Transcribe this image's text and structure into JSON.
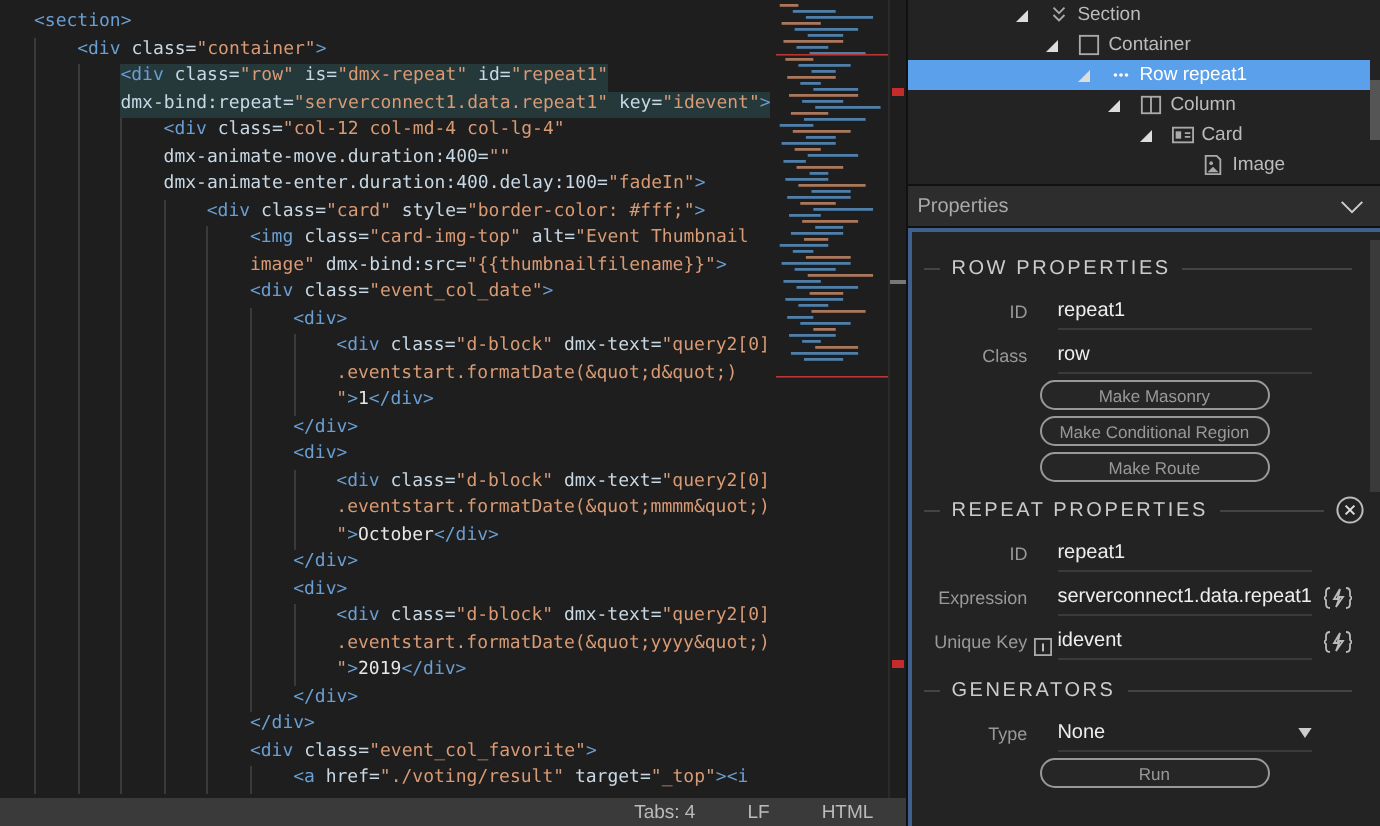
{
  "editor": {
    "lines": [
      {
        "highlighted": false,
        "parts": [
          {
            "kind": "tag",
            "text": "<section>"
          }
        ],
        "children": [
          {
            "highlighted": false,
            "parts": [
              {
                "kind": "tag",
                "text": "<div"
              },
              {
                "kind": "attr",
                "text": " class="
              },
              {
                "kind": "str",
                "text": "\"container\""
              },
              {
                "kind": "tag",
                "text": ">"
              }
            ],
            "children": [
              {
                "highlighted": true,
                "parts": [
                  {
                    "kind": "tag",
                    "text": "<div"
                  },
                  {
                    "kind": "attr",
                    "text": " class="
                  },
                  {
                    "kind": "str",
                    "text": "\"row\""
                  },
                  {
                    "kind": "attr",
                    "text": " is="
                  },
                  {
                    "kind": "str",
                    "text": "\"dmx-repeat\""
                  },
                  {
                    "kind": "attr",
                    "text": " id="
                  },
                  {
                    "kind": "str",
                    "text": "\"repeat1\""
                  }
                ]
              },
              {
                "highlighted": true,
                "parts": [
                  {
                    "kind": "attr",
                    "text": "dmx-bind:repeat="
                  },
                  {
                    "kind": "str",
                    "text": "\"serverconnect1.data.repeat1\""
                  },
                  {
                    "kind": "attr",
                    "text": " key="
                  },
                  {
                    "kind": "str",
                    "text": "\"idevent\""
                  },
                  {
                    "kind": "tag",
                    "text": ">"
                  }
                ],
                "children": [
                  {
                    "highlighted": false,
                    "parts": [
                      {
                        "kind": "tag",
                        "text": "<div"
                      },
                      {
                        "kind": "attr",
                        "text": " class="
                      },
                      {
                        "kind": "str",
                        "text": "\"col-12 col-md-4 col-lg-4\""
                      }
                    ]
                  },
                  {
                    "highlighted": false,
                    "parts": [
                      {
                        "kind": "attr",
                        "text": "dmx-animate-move.duration:400="
                      },
                      {
                        "kind": "str",
                        "text": "\"\""
                      }
                    ]
                  },
                  {
                    "highlighted": false,
                    "parts": [
                      {
                        "kind": "attr",
                        "text": "dmx-animate-enter.duration:400.delay:100="
                      },
                      {
                        "kind": "str",
                        "text": "\"fadeIn\""
                      },
                      {
                        "kind": "tag",
                        "text": ">"
                      }
                    ],
                    "children": [
                      {
                        "highlighted": false,
                        "parts": [
                          {
                            "kind": "tag",
                            "text": "<div"
                          },
                          {
                            "kind": "attr",
                            "text": " class="
                          },
                          {
                            "kind": "str",
                            "text": "\"card\""
                          },
                          {
                            "kind": "attr",
                            "text": " style="
                          },
                          {
                            "kind": "str",
                            "text": "\"border-color: #fff;\""
                          },
                          {
                            "kind": "tag",
                            "text": ">"
                          }
                        ],
                        "children": [
                          {
                            "highlighted": false,
                            "parts": [
                              {
                                "kind": "tag",
                                "text": "<img"
                              },
                              {
                                "kind": "attr",
                                "text": " class="
                              },
                              {
                                "kind": "str",
                                "text": "\"card-img-top\""
                              },
                              {
                                "kind": "attr",
                                "text": " alt="
                              },
                              {
                                "kind": "str",
                                "text": "\"Event Thumbnail"
                              }
                            ]
                          },
                          {
                            "highlighted": false,
                            "parts": [
                              {
                                "kind": "str",
                                "text": "image\""
                              },
                              {
                                "kind": "attr",
                                "text": " dmx-bind:src="
                              },
                              {
                                "kind": "str",
                                "text": "\"{{thumbnailfilename}}\""
                              },
                              {
                                "kind": "tag",
                                "text": ">"
                              }
                            ]
                          },
                          {
                            "highlighted": false,
                            "parts": [
                              {
                                "kind": "tag",
                                "text": "<div"
                              },
                              {
                                "kind": "attr",
                                "text": " class="
                              },
                              {
                                "kind": "str",
                                "text": "\"event_col_date\""
                              },
                              {
                                "kind": "tag",
                                "text": ">"
                              }
                            ],
                            "children": [
                              {
                                "highlighted": false,
                                "parts": [
                                  {
                                    "kind": "tag",
                                    "text": "<div>"
                                  }
                                ],
                                "children": [
                                  {
                                    "highlighted": false,
                                    "parts": [
                                      {
                                        "kind": "tag",
                                        "text": "<div"
                                      },
                                      {
                                        "kind": "attr",
                                        "text": " class="
                                      },
                                      {
                                        "kind": "str",
                                        "text": "\"d-block\""
                                      },
                                      {
                                        "kind": "attr",
                                        "text": " dmx-text="
                                      },
                                      {
                                        "kind": "str",
                                        "text": "\"query2[0]"
                                      }
                                    ]
                                  },
                                  {
                                    "highlighted": false,
                                    "parts": [
                                      {
                                        "kind": "str",
                                        "text": ".eventstart.formatDate(&quot;d&quot;)"
                                      }
                                    ]
                                  },
                                  {
                                    "highlighted": false,
                                    "parts": [
                                      {
                                        "kind": "str",
                                        "text": "\""
                                      },
                                      {
                                        "kind": "tag",
                                        "text": ">"
                                      },
                                      {
                                        "kind": "text",
                                        "text": "1"
                                      },
                                      {
                                        "kind": "tag",
                                        "text": "</div>"
                                      }
                                    ]
                                  }
                                ]
                              },
                              {
                                "highlighted": false,
                                "parts": [
                                  {
                                    "kind": "tag",
                                    "text": "</div>"
                                  }
                                ]
                              },
                              {
                                "highlighted": false,
                                "parts": [
                                  {
                                    "kind": "tag",
                                    "text": "<div>"
                                  }
                                ],
                                "children": [
                                  {
                                    "highlighted": false,
                                    "parts": [
                                      {
                                        "kind": "tag",
                                        "text": "<div"
                                      },
                                      {
                                        "kind": "attr",
                                        "text": " class="
                                      },
                                      {
                                        "kind": "str",
                                        "text": "\"d-block\""
                                      },
                                      {
                                        "kind": "attr",
                                        "text": " dmx-text="
                                      },
                                      {
                                        "kind": "str",
                                        "text": "\"query2[0]"
                                      }
                                    ]
                                  },
                                  {
                                    "highlighted": false,
                                    "parts": [
                                      {
                                        "kind": "str",
                                        "text": ".eventstart.formatDate(&quot;mmmm&quot;)"
                                      }
                                    ]
                                  },
                                  {
                                    "highlighted": false,
                                    "parts": [
                                      {
                                        "kind": "str",
                                        "text": "\""
                                      },
                                      {
                                        "kind": "tag",
                                        "text": ">"
                                      },
                                      {
                                        "kind": "text",
                                        "text": "October"
                                      },
                                      {
                                        "kind": "tag",
                                        "text": "</div>"
                                      }
                                    ]
                                  }
                                ]
                              },
                              {
                                "highlighted": false,
                                "parts": [
                                  {
                                    "kind": "tag",
                                    "text": "</div>"
                                  }
                                ]
                              },
                              {
                                "highlighted": false,
                                "parts": [
                                  {
                                    "kind": "tag",
                                    "text": "<div>"
                                  }
                                ],
                                "children": [
                                  {
                                    "highlighted": false,
                                    "parts": [
                                      {
                                        "kind": "tag",
                                        "text": "<div"
                                      },
                                      {
                                        "kind": "attr",
                                        "text": " class="
                                      },
                                      {
                                        "kind": "str",
                                        "text": "\"d-block\""
                                      },
                                      {
                                        "kind": "attr",
                                        "text": " dmx-text="
                                      },
                                      {
                                        "kind": "str",
                                        "text": "\"query2[0]"
                                      }
                                    ]
                                  },
                                  {
                                    "highlighted": false,
                                    "parts": [
                                      {
                                        "kind": "str",
                                        "text": ".eventstart.formatDate(&quot;yyyy&quot;)"
                                      }
                                    ]
                                  },
                                  {
                                    "highlighted": false,
                                    "parts": [
                                      {
                                        "kind": "str",
                                        "text": "\""
                                      },
                                      {
                                        "kind": "tag",
                                        "text": ">"
                                      },
                                      {
                                        "kind": "text",
                                        "text": "2019"
                                      },
                                      {
                                        "kind": "tag",
                                        "text": "</div>"
                                      }
                                    ]
                                  }
                                ]
                              },
                              {
                                "highlighted": false,
                                "parts": [
                                  {
                                    "kind": "tag",
                                    "text": "</div>"
                                  }
                                ]
                              }
                            ]
                          },
                          {
                            "highlighted": false,
                            "parts": [
                              {
                                "kind": "tag",
                                "text": "</div>"
                              }
                            ]
                          },
                          {
                            "highlighted": false,
                            "parts": [
                              {
                                "kind": "tag",
                                "text": "<div"
                              },
                              {
                                "kind": "attr",
                                "text": " class="
                              },
                              {
                                "kind": "str",
                                "text": "\"event_col_favorite\""
                              },
                              {
                                "kind": "tag",
                                "text": ">"
                              }
                            ],
                            "children": [
                              {
                                "highlighted": false,
                                "parts": [
                                  {
                                    "kind": "tag",
                                    "text": "<a"
                                  },
                                  {
                                    "kind": "attr",
                                    "text": " href="
                                  },
                                  {
                                    "kind": "str",
                                    "text": "\"./voting/result\""
                                  },
                                  {
                                    "kind": "attr",
                                    "text": " target="
                                  },
                                  {
                                    "kind": "str",
                                    "text": "\"_top\""
                                  },
                                  {
                                    "kind": "tag",
                                    "text": "><i"
                                  }
                                ]
                              }
                            ]
                          }
                        ]
                      }
                    ]
                  }
                ]
              }
            ]
          }
        ]
      }
    ]
  },
  "status_bar": {
    "tabs": "Tabs: 4",
    "line_ending": "LF",
    "language": "HTML"
  },
  "tree": [
    {
      "label": "Section",
      "kind": "section",
      "selected": false,
      "children": [
        {
          "label": "Container",
          "kind": "container",
          "selected": false,
          "children": [
            {
              "label": "Row repeat1",
              "kind": "row",
              "selected": true,
              "children": [
                {
                  "label": "Column",
                  "kind": "column",
                  "selected": false,
                  "children": [
                    {
                      "label": "Card",
                      "kind": "card",
                      "selected": false,
                      "children": [
                        {
                          "label": "Image",
                          "kind": "image",
                          "selected": false
                        }
                      ]
                    }
                  ]
                }
              ]
            }
          ]
        }
      ]
    }
  ],
  "properties": {
    "title": "Properties",
    "sections": [
      {
        "title": "ROW PROPERTIES",
        "closable": false,
        "fields": [
          {
            "label": "ID",
            "value": "repeat1",
            "kind": "text",
            "info": false,
            "dynamic": false
          },
          {
            "label": "Class",
            "value": "row",
            "kind": "text",
            "info": false,
            "dynamic": false
          }
        ],
        "buttons": [
          "Make Masonry",
          "Make Conditional Region",
          "Make Route"
        ]
      },
      {
        "title": "REPEAT PROPERTIES",
        "closable": true,
        "fields": [
          {
            "label": "ID",
            "value": "repeat1",
            "kind": "text",
            "info": false,
            "dynamic": false
          },
          {
            "label": "Expression",
            "value": "serverconnect1.data.repeat1",
            "kind": "text",
            "info": false,
            "dynamic": true
          },
          {
            "label": "Unique Key",
            "value": "idevent",
            "kind": "text",
            "info": true,
            "dynamic": true
          }
        ]
      },
      {
        "title": "GENERATORS",
        "closable": false,
        "fields": [
          {
            "label": "Type",
            "value": "None",
            "kind": "select",
            "info": false,
            "dynamic": false
          }
        ],
        "buttons": [
          "Run"
        ]
      }
    ]
  }
}
